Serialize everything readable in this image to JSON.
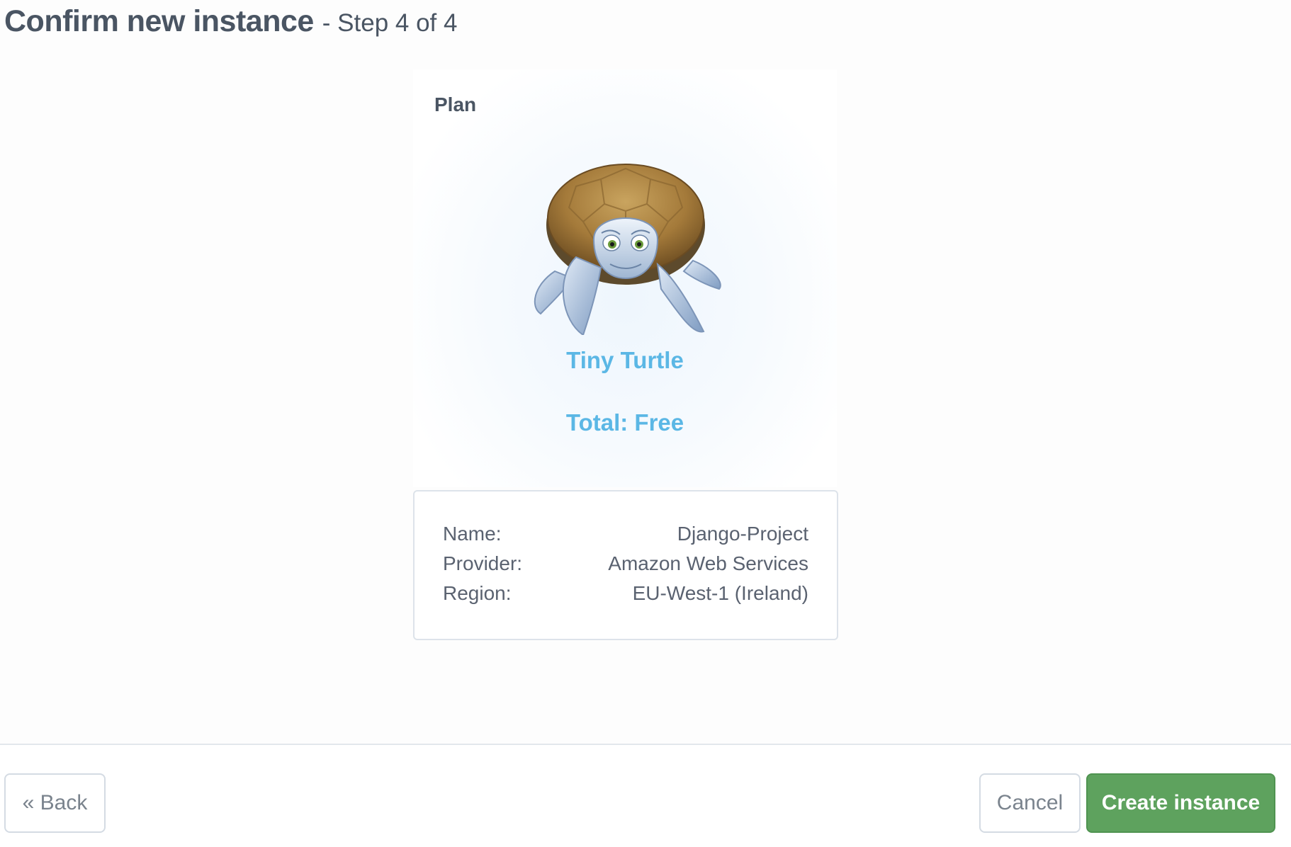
{
  "header": {
    "title": "Confirm new instance",
    "step": "- Step 4 of 4"
  },
  "plan": {
    "label": "Plan",
    "illustration": "turtle-mascot",
    "name": "Tiny Turtle",
    "total": "Total: Free"
  },
  "details": {
    "rows": [
      {
        "label": "Name:",
        "value": "Django-Project"
      },
      {
        "label": "Provider:",
        "value": "Amazon Web Services"
      },
      {
        "label": "Region:",
        "value": "EU-West-1 (Ireland)"
      }
    ]
  },
  "footer": {
    "back_label": "« Back",
    "cancel_label": "Cancel",
    "create_label": "Create instance"
  },
  "colors": {
    "accent_blue": "#5bb7e5",
    "create_green": "#5ea25e",
    "text_dark": "#4a5563"
  }
}
